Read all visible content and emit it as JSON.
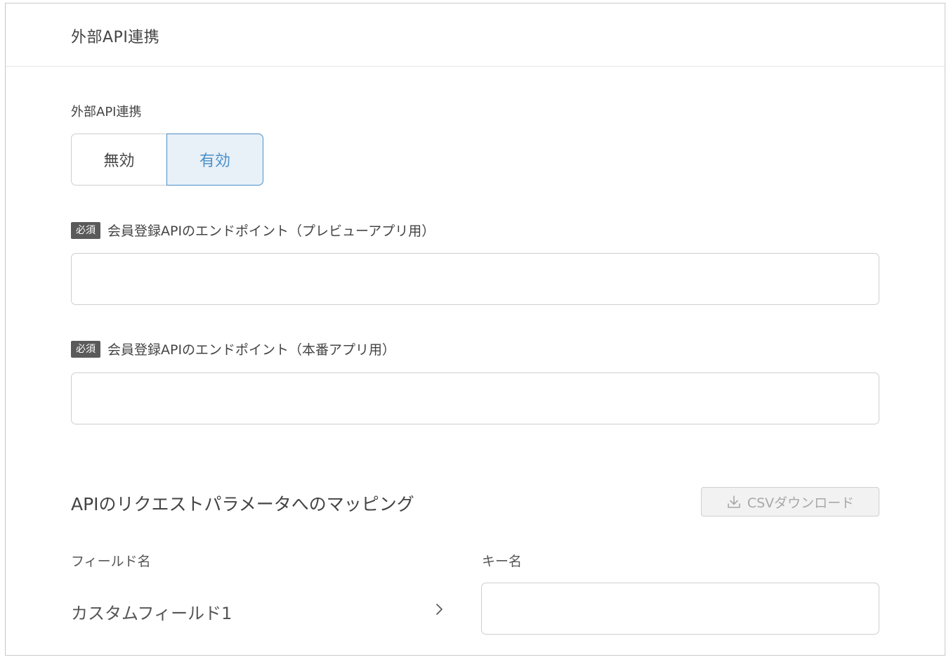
{
  "panel": {
    "title": "外部API連携"
  },
  "api_integration": {
    "label": "外部API連携",
    "options": [
      "無効",
      "有効"
    ],
    "selected": "有効"
  },
  "endpoint_preview": {
    "required_badge": "必須",
    "label": "会員登録APIのエンドポイント（プレビューアプリ用）",
    "value": "",
    "placeholder": ""
  },
  "endpoint_production": {
    "required_badge": "必須",
    "label": "会員登録APIのエンドポイント（本番アプリ用）",
    "value": "",
    "placeholder": ""
  },
  "mapping": {
    "title": "APIのリクエストパラメータへのマッピング",
    "csv_download_label": "CSVダウンロード",
    "csv_download_icon": "download-icon",
    "columns": {
      "field_name": "フィールド名",
      "key_name": "キー名"
    },
    "rows": [
      {
        "field": "カスタムフィールド1",
        "arrow_icon": "chevron-right-icon",
        "key": ""
      }
    ]
  },
  "colors": {
    "accent": "#4a90c8",
    "accent_bg": "#e8f0f8",
    "badge_bg": "#5a5a5a",
    "border": "#cfcfcf"
  }
}
